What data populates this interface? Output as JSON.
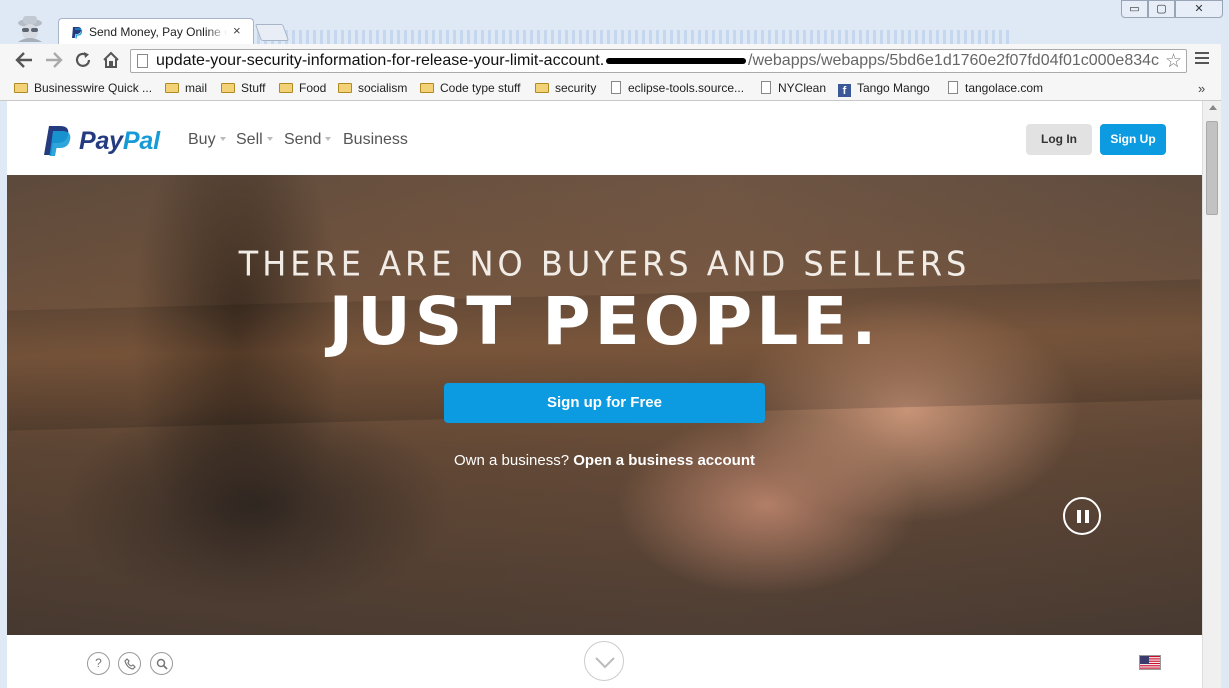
{
  "browser": {
    "tab_title": "Send Money, Pay Online o",
    "tab_close": "×",
    "window_controls": {
      "minimize": "▭",
      "maximize": "▢",
      "close": "✕"
    },
    "url_host": "update-your-security-information-for-release-your-limit-account.",
    "url_path": "/webapps/webapps/5bd6e1d1760e2f07fd04f01c000e834c",
    "bookmarks": [
      {
        "label": "Businesswire Quick ...",
        "icon": "folder-icon"
      },
      {
        "label": "mail",
        "icon": "folder-icon"
      },
      {
        "label": "Stuff",
        "icon": "folder-icon"
      },
      {
        "label": "Food",
        "icon": "folder-icon"
      },
      {
        "label": "socialism",
        "icon": "folder-icon"
      },
      {
        "label": "Code type stuff",
        "icon": "folder-icon"
      },
      {
        "label": "security",
        "icon": "folder-icon"
      },
      {
        "label": "eclipse-tools.source...",
        "icon": "page-icon"
      },
      {
        "label": "NYClean",
        "icon": "page-icon"
      },
      {
        "label": "Tango Mango",
        "icon": "facebook-icon"
      },
      {
        "label": "tangolace.com",
        "icon": "page-icon"
      }
    ],
    "bookmarks_overflow": "»"
  },
  "site": {
    "logo": {
      "word1": "Pay",
      "word2": "Pal"
    },
    "nav": [
      {
        "label": "Buy",
        "has_dropdown": true
      },
      {
        "label": "Sell",
        "has_dropdown": true
      },
      {
        "label": "Send",
        "has_dropdown": true
      },
      {
        "label": "Business",
        "has_dropdown": false
      }
    ],
    "login_label": "Log In",
    "signup_label": "Sign Up"
  },
  "hero": {
    "tagline": "THERE ARE NO BUYERS AND SELLERS",
    "headline": "JUST PEOPLE.",
    "cta_label": "Sign up for Free",
    "business_prompt": "Own a business?",
    "business_link": "Open a business account"
  },
  "footer": {
    "help_icon_glyph": "?",
    "icons": [
      "help-icon",
      "phone-icon",
      "search-icon",
      "chevron-down-icon",
      "us-flag-icon"
    ]
  },
  "colors": {
    "paypal_dark_blue": "#253b80",
    "paypal_light_blue": "#179bd7",
    "button_blue": "#0c9ae0",
    "login_gray": "#e2e2e2"
  }
}
